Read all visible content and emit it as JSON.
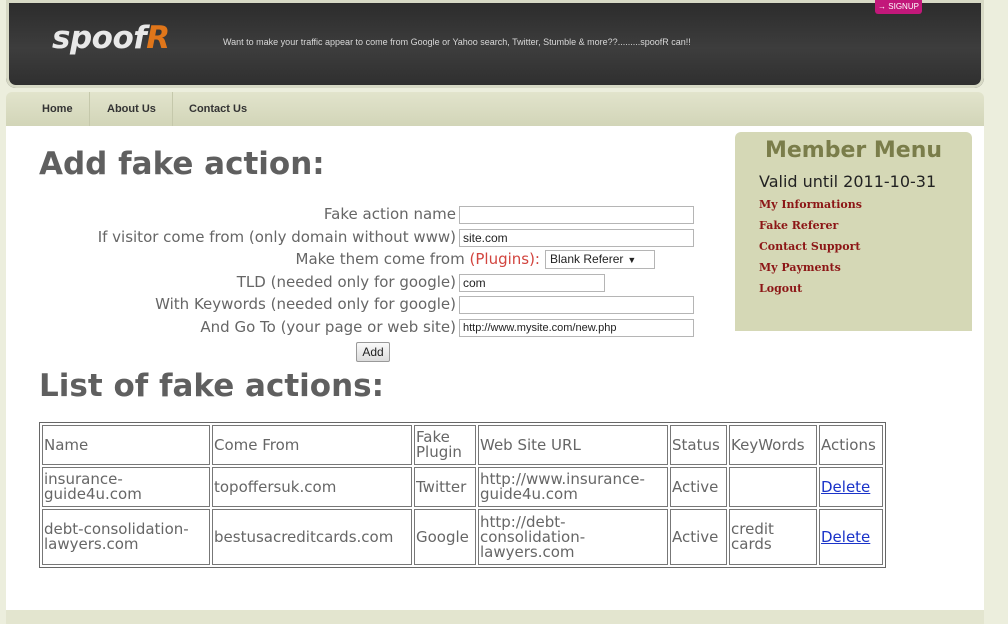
{
  "header": {
    "logo_main": "spoof",
    "logo_accent": "R",
    "tagline": "Want to make your traffic appear to come from Google or Yahoo search, Twitter, Stumble & more??.........spoofR can!!",
    "signup_label": "→ SIGNUP"
  },
  "nav": {
    "items": [
      {
        "label": "Home"
      },
      {
        "label": "About Us"
      },
      {
        "label": "Contact Us"
      }
    ]
  },
  "form": {
    "title": "Add fake action:",
    "fields": [
      {
        "label": "Fake action name",
        "value": ""
      },
      {
        "label": "If visitor come from (only domain without www)",
        "value": "site.com"
      },
      {
        "label": "Make them come from",
        "plugins_label": "(Plugins):",
        "value": "Blank Referer"
      },
      {
        "label": "TLD (needed only for google)",
        "value": "com"
      },
      {
        "label": "With Keywords (needed only for google)",
        "value": ""
      },
      {
        "label": "And Go To (your page or web site)",
        "value": "http://www.mysite.com/new.php"
      }
    ],
    "add_label": "Add"
  },
  "list": {
    "title": "List of fake actions:",
    "columns": [
      "Name",
      "Come From",
      "Fake Plugin",
      "Web Site URL",
      "Status",
      "KeyWords",
      "Actions"
    ],
    "rows": [
      {
        "name": "insurance-guide4u.com",
        "come_from": "topoffersuk.com",
        "plugin": "Twitter",
        "url": "http://www.insurance-guide4u.com",
        "status": "Active",
        "keywords": "",
        "action": "Delete"
      },
      {
        "name": "debt-consolidation-lawyers.com",
        "come_from": "bestusacreditcards.com",
        "plugin": "Google",
        "url": "http://debt-consolidation-lawyers.com",
        "status": "Active",
        "keywords": "credit cards",
        "action": "Delete"
      }
    ]
  },
  "member_menu": {
    "title": "Member Menu",
    "valid_until": "Valid until 2011-10-31",
    "links": [
      {
        "label": "My Informations"
      },
      {
        "label": "Fake Referer"
      },
      {
        "label": "Contact Support"
      },
      {
        "label": "My Payments"
      },
      {
        "label": "Logout"
      }
    ]
  },
  "colors": {
    "page_bg": "#eceedd",
    "header_bg": "#333333",
    "accent_logo": "#e0761a",
    "signup_bg": "#c2187a",
    "link_red": "#8c1616",
    "plugins_red": "#d2453f"
  }
}
